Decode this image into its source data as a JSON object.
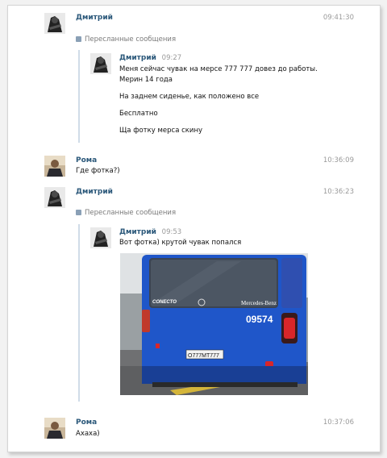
{
  "messages": [
    {
      "sender": "Дмитрий",
      "time": "09:41:30"
    },
    {
      "sender": "Рома",
      "time": "10:36:09",
      "text": "Где фотка?)"
    },
    {
      "sender": "Дмитрий",
      "time": "10:36:23"
    },
    {
      "sender": "Рома",
      "time": "10:37:06",
      "text": "Ахаха)"
    }
  ],
  "forwarded_label": "Пересланные сообщения",
  "forward1": {
    "sender": "Дмитрий",
    "time": "09:27",
    "lines": [
      "Меня сейчас чувак на мерсе 777 777 довез до работы.",
      "Мерин 14 года",
      "На заднем сиденье, как положено все",
      "Бесплатно",
      "Ща фотку мерса скину"
    ]
  },
  "forward2": {
    "sender": "Дмитрий",
    "time": "09:53",
    "text": "Вот фотка) крутой чувак попался",
    "photo": {
      "brand_left": "CONECTO",
      "brand_right": "Mercedes-Benz",
      "route_number": "09574",
      "plate": "О777МТ777"
    }
  },
  "colors": {
    "name": "#2b587a",
    "bus": "#1f56c9",
    "time": "#9a9a9a"
  }
}
